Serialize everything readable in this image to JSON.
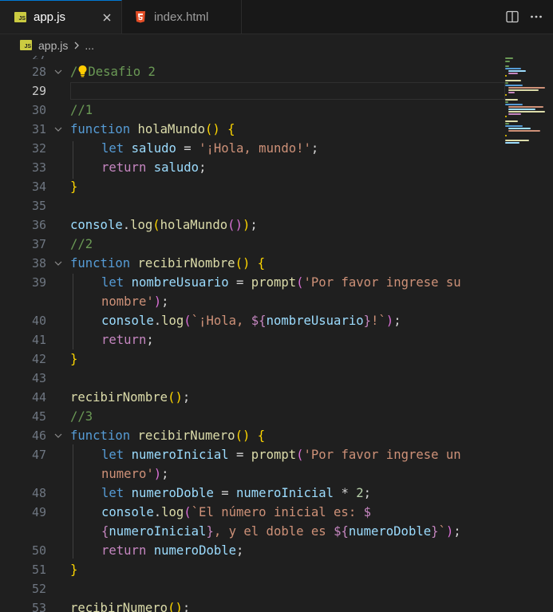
{
  "tabs": [
    {
      "label": "app.js",
      "badge": "JS",
      "active": true
    },
    {
      "label": "index.html",
      "active": false
    }
  ],
  "breadcrumb": {
    "badge": "JS",
    "file": "app.js",
    "more": "..."
  },
  "current_line": 29,
  "partial_line_number": "27",
  "lines": [
    {
      "n": "28",
      "text": "Desafio 2"
    },
    {
      "n": "29",
      "text": ""
    },
    {
      "n": "30",
      "text": "//1"
    },
    {
      "n": "31",
      "text": "function holaMundo() {"
    },
    {
      "n": "32",
      "text": "let saludo = '¡Hola, mundo!';"
    },
    {
      "n": "33",
      "text": "return saludo;"
    },
    {
      "n": "34",
      "text": "}"
    },
    {
      "n": "35",
      "text": ""
    },
    {
      "n": "36",
      "text": "console.log(holaMundo());"
    },
    {
      "n": "37",
      "text": "//2"
    },
    {
      "n": "38",
      "text": "function recibirNombre() {"
    },
    {
      "n": "39",
      "text": "let nombreUsuario = prompt('Por favor ingrese su"
    },
    {
      "n": "",
      "text": "nombre');"
    },
    {
      "n": "40",
      "text": "console.log(`¡Hola, ${nombreUsuario}!`);"
    },
    {
      "n": "41",
      "text": "return;"
    },
    {
      "n": "42",
      "text": "}"
    },
    {
      "n": "43",
      "text": ""
    },
    {
      "n": "44",
      "text": "recibirNombre();"
    },
    {
      "n": "45",
      "text": "//3"
    },
    {
      "n": "46",
      "text": "function recibirNumero() {"
    },
    {
      "n": "47",
      "text": "let numeroInicial = prompt('Por favor ingrese un"
    },
    {
      "n": "",
      "text": "numero');"
    },
    {
      "n": "48",
      "text": "let numeroDoble = numeroInicial * 2;"
    },
    {
      "n": "49",
      "text": "console.log(`El número inicial es: $"
    },
    {
      "n": "",
      "text": "{numeroInicial}, y el doble es ${numeroDoble}`);"
    },
    {
      "n": "50",
      "text": "return numeroDoble;"
    },
    {
      "n": "51",
      "text": "}"
    },
    {
      "n": "52",
      "text": ""
    },
    {
      "n": "53",
      "text": "recibirNumero();"
    }
  ],
  "colors": {
    "background": "#1f1f1f",
    "tab_bar": "#181818",
    "accent": "#0078d4",
    "keyword": "#569cd6",
    "control": "#c586c0",
    "function": "#dcdcaa",
    "variable": "#9cdcfe",
    "string": "#ce9178",
    "number": "#b5cea8",
    "comment": "#6a9955",
    "bracket_1": "#ffd700",
    "bracket_2": "#da70d6",
    "bracket_3": "#179fff"
  },
  "icons": [
    "js-file-icon",
    "html5-file-icon",
    "close-icon",
    "split-editor-icon",
    "more-actions-icon",
    "chevron-right-icon",
    "chevron-down-icon",
    "lightbulb-icon"
  ]
}
